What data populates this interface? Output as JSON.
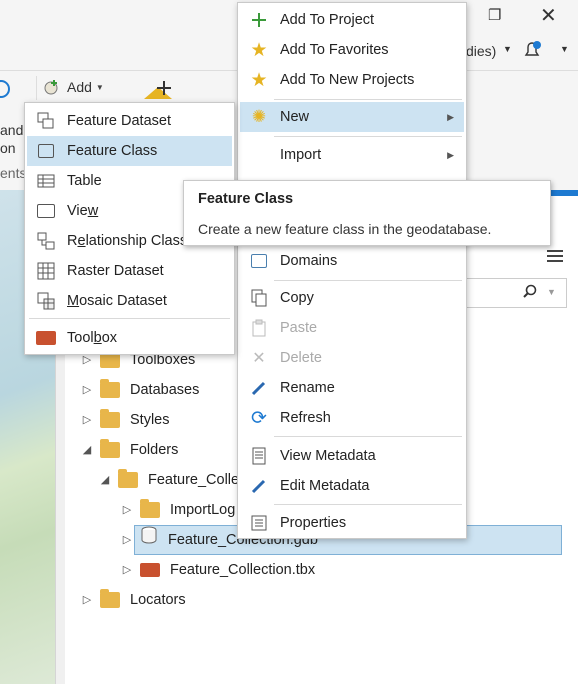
{
  "ribbon": {
    "add_label": "Add",
    "left_text_1": "and",
    "left_text_2": "on",
    "left_text_3": "ents",
    "portal_text": "dies)"
  },
  "tree": {
    "toolboxes": "Toolboxes",
    "databases": "Databases",
    "styles": "Styles",
    "folders": "Folders",
    "feature_collection_folder": "Feature_Colle",
    "importlog": "ImportLog",
    "gdb": "Feature_Collection.gdb",
    "tbx": "Feature_Collection.tbx",
    "locators": "Locators"
  },
  "context_menu": {
    "add_to_project": "Add To Project",
    "add_to_favorites": "Add To Favorites",
    "add_to_new_projects": "Add To New Projects",
    "new": "New",
    "import": "Import",
    "domains": "Domains",
    "copy": "Copy",
    "paste": "Paste",
    "delete": "Delete",
    "rename": "Rename",
    "refresh": "Refresh",
    "view_metadata": "View Metadata",
    "edit_metadata": "Edit Metadata",
    "properties": "Properties"
  },
  "new_submenu": {
    "feature_dataset": "Feature Dataset",
    "feature_class": "Feature Class",
    "table": "Table",
    "view_pre": "Vie",
    "view_u": "w",
    "relationship_pre": "R",
    "relationship_u": "e",
    "relationship_post": "lationship Class",
    "raster_dataset": "Raster Dataset",
    "mosaic_u": "M",
    "mosaic_post": "osaic Dataset",
    "toolbox_pre": "Tool",
    "toolbox_u": "b",
    "toolbox_post": "ox"
  },
  "tooltip": {
    "title": "Feature Class",
    "description": "Create a new feature class in the geodatabase."
  },
  "colors": {
    "highlight": "#cde3f2",
    "accent_blue": "#1e7ad1",
    "folder": "#e8b64a",
    "star": "#e6b423",
    "plus_green": "#3a9a3a"
  }
}
